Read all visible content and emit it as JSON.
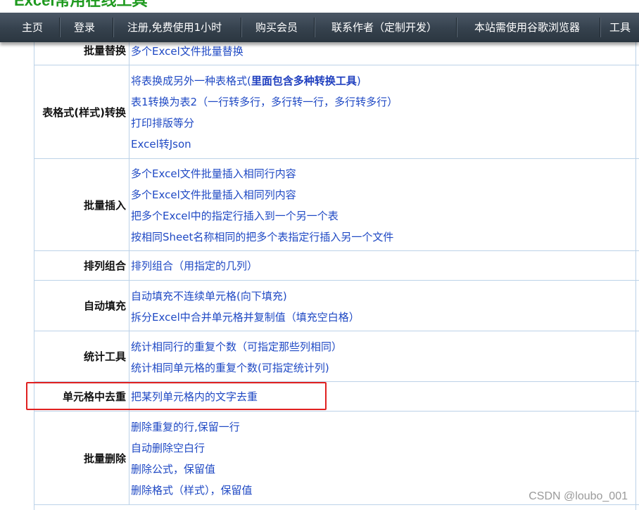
{
  "site": {
    "title": "Excel常用在线工具"
  },
  "nav": {
    "items": [
      {
        "label": "主页"
      },
      {
        "label": "登录"
      },
      {
        "label": "注册,免费使用1小时"
      },
      {
        "label": "购买会员"
      },
      {
        "label": "联系作者（定制开发）"
      },
      {
        "label": "本站需使用谷歌浏览器"
      },
      {
        "label": "工具"
      }
    ]
  },
  "table": {
    "top_partial": {
      "category": "批量替换",
      "link": "多个Excel文件批量替换"
    },
    "rows": [
      {
        "category": "表格式(样式)转换",
        "links": [
          "将表换成另外一种表格式(",
          "里面包含多种转换工具",
          ")",
          "表1转换为表2（一行转多行，多行转一行，多行转多行）",
          "打印排版等分",
          "Excel转Json"
        ]
      },
      {
        "category": "批量插入",
        "links": [
          "多个Excel文件批量插入相同行内容",
          "多个Excel文件批量插入相同列内容",
          "把多个Excel中的指定行插入到一个另一个表",
          "按相同Sheet名称相同的把多个表指定行插入另一个文件"
        ]
      },
      {
        "category": "排列组合",
        "links": [
          "排列组合（用指定的几列）"
        ]
      },
      {
        "category": "自动填充",
        "links": [
          "自动填充不连续单元格(向下填充)",
          "拆分Excel中合并单元格并复制值（填充空白格）"
        ]
      },
      {
        "category": "统计工具",
        "links": [
          "统计相同行的重复个数（可指定那些列相同）",
          "统计相同单元格的重复个数(可指定统计列)"
        ]
      },
      {
        "category": "单元格中去重",
        "links": [
          "把某列单元格内的文字去重"
        ]
      },
      {
        "category": "批量删除",
        "links": [
          "删除重复的行,保留一行",
          "自动删除空白行",
          "删除公式，保留值",
          "删除格式（样式），保留值"
        ]
      }
    ]
  },
  "watermark": "CSDN @loubo_001"
}
